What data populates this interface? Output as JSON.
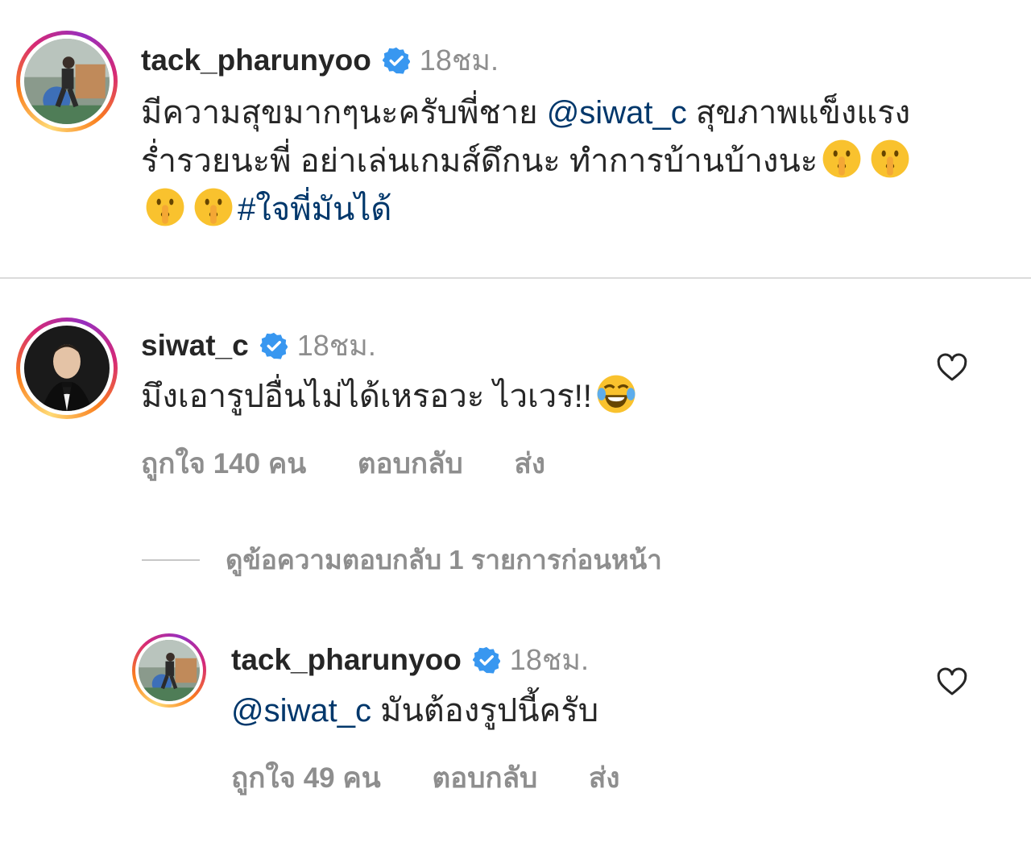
{
  "comments": [
    {
      "username": "tack_pharunyoo",
      "time": "18ชม.",
      "text_line1_a": "มีความสุขมากๆนะครับพี่ชาย ",
      "mention": "@siwat_c",
      "text_line1_b": " สุขภาพแข็งแรง",
      "text_line2": "ร่ำรวยนะพี่ อย่าเล่นเกมส์ดึกนะ ทำการบ้านบ้างนะ",
      "hashtag": "#ใจพี่มันได้",
      "emoji": "shushing-face-emoji"
    },
    {
      "username": "siwat_c",
      "time": "18ชม.",
      "text": "มึงเอารูปอื่นไม่ได้เหรอวะ ไวเวร!!",
      "emoji": "tears-of-joy-emoji",
      "likes": "ถูกใจ 140 คน",
      "reply": "ตอบกลับ",
      "send": "ส่ง"
    }
  ],
  "view_replies": "ดูข้อความตอบกลับ 1 รายการก่อนหน้า",
  "reply_comment": {
    "username": "tack_pharunyoo",
    "time": "18ชม.",
    "mention": "@siwat_c",
    "text": " มันต้องรูปนี้ครับ",
    "likes": "ถูกใจ 49 คน",
    "reply": "ตอบกลับ",
    "send": "ส่ง"
  },
  "colors": {
    "verified": "#3897f0",
    "link": "#00376b",
    "secondary": "#8e8e8e"
  }
}
